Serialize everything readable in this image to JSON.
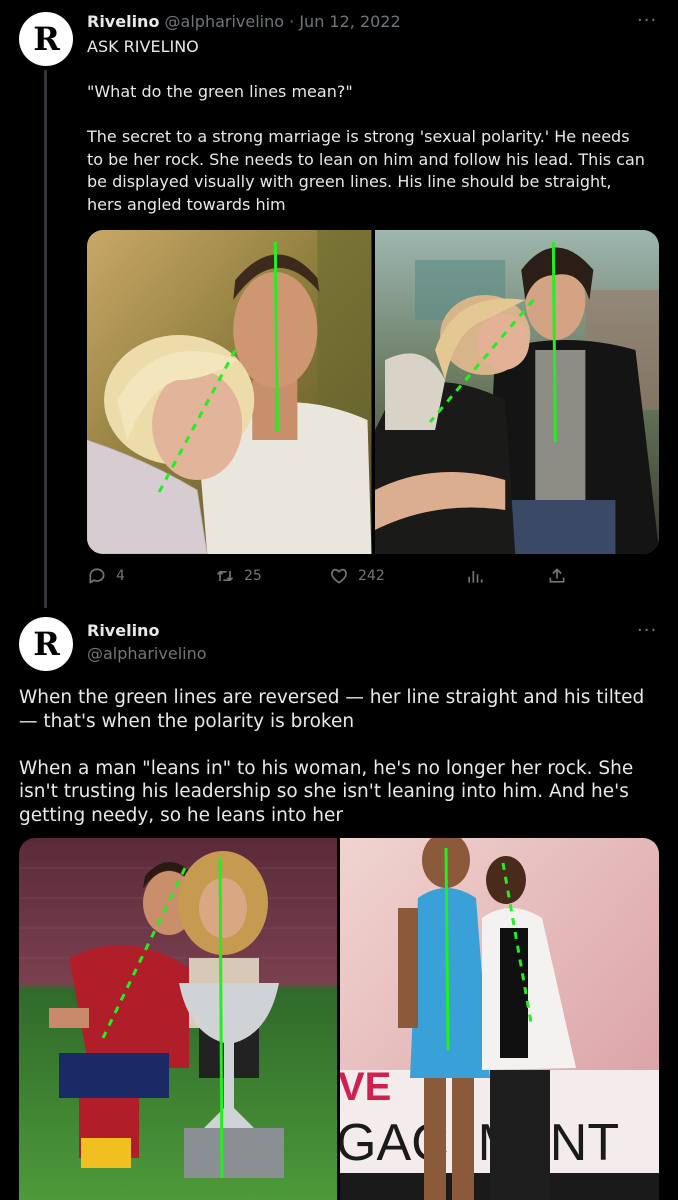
{
  "tweet1": {
    "author_name": "Rivelino",
    "handle": "@alpharivelino",
    "separator": "·",
    "date": "Jun 12, 2022",
    "text": "ASK RIVELINO\n\n\"What do the green lines mean?\"\n\nThe secret to a strong marriage is strong 'sexual polarity.' He needs to be her rock. She needs to lean on him and follow his lead. This can be displayed visually with green lines. His line should be straight, hers angled towards him",
    "actions": {
      "replies": "4",
      "retweets": "25",
      "likes": "242"
    },
    "avatar_letter": "R",
    "more_label": "···"
  },
  "tweet2": {
    "author_name": "Rivelino",
    "handle": "@alpharivelino",
    "text": "When the green lines are reversed — her line straight and his tilted — that's when the polarity is broken\n\nWhen a man \"leans in\" to his woman, he's no longer her rock. She isn't trusting his leadership so she isn't leaning into him. And he's getting needy, so he leans into her",
    "avatar_letter": "R",
    "more_label": "···",
    "photo_signage": {
      "left_letters": "VE",
      "bottom_text": "GAC  M  NT"
    }
  },
  "colors": {
    "background": "#000000",
    "text": "#e7e9ea",
    "muted": "#71767b",
    "line_green": "#22ee22"
  },
  "icons": [
    "reply-icon",
    "retweet-icon",
    "like-icon",
    "analytics-icon",
    "share-icon",
    "more-icon"
  ]
}
